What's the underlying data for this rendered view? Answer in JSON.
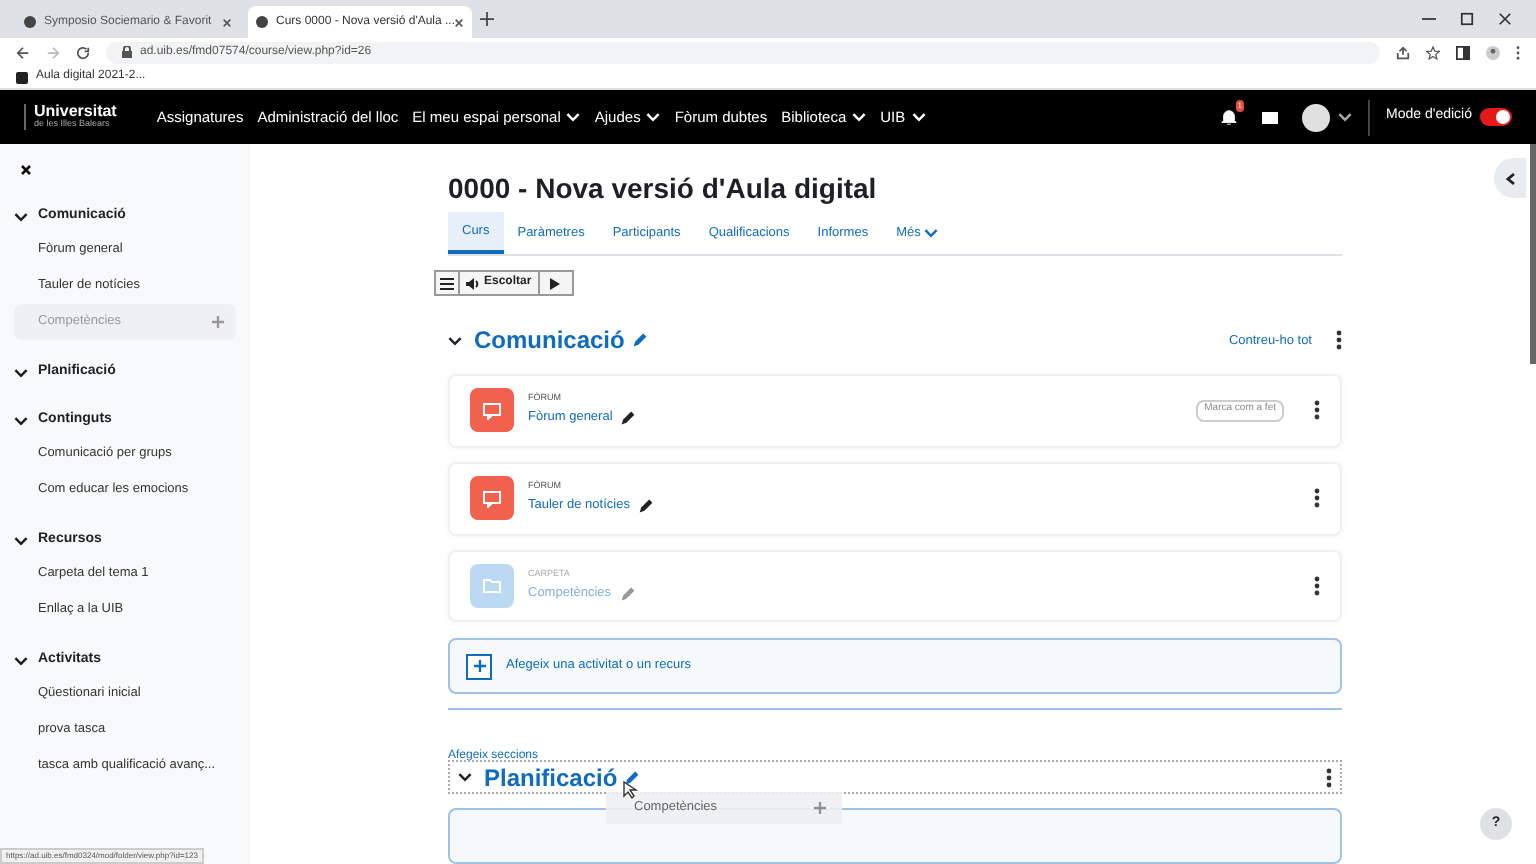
{
  "browser": {
    "tabs": [
      {
        "title": "Symposio Sociemario & Favorit",
        "selected": false
      },
      {
        "title": "Curs 0000 - Nova versió d'Aula ...",
        "selected": true
      }
    ],
    "url": "ad.uib.es/fmd07574/course/view.php?id=26",
    "bookmarks": [
      "Aula digital 2021-2..."
    ]
  },
  "nav": {
    "logo_title": "Universitat",
    "logo_subtitle": "de les Illes Balears",
    "items": [
      {
        "label": "Assignatures",
        "dropdown": false
      },
      {
        "label": "Administració del lloc",
        "dropdown": false
      },
      {
        "label": "El meu espai personal",
        "dropdown": true
      },
      {
        "label": "Ajudes",
        "dropdown": true
      },
      {
        "label": "Fòrum dubtes",
        "dropdown": false
      },
      {
        "label": "Biblioteca",
        "dropdown": true
      },
      {
        "label": "UIB",
        "dropdown": true
      }
    ],
    "notification_count": "1",
    "edit_mode": {
      "label": "Mode d'edició",
      "on": true
    }
  },
  "sidebar": {
    "sections": [
      {
        "title": "Comunicació",
        "expanded": true,
        "items": [
          {
            "label": "Fòrum general",
            "selected": false,
            "dimmed": false
          },
          {
            "label": "Tauler de notícies",
            "selected": false,
            "dimmed": false
          },
          {
            "label": "Competències",
            "selected": true,
            "dimmed": true
          }
        ]
      },
      {
        "title": "Planificació",
        "expanded": true
      },
      {
        "title": "Continguts",
        "expanded": true,
        "items": [
          {
            "label": "Comunicació per grups",
            "selected": false,
            "dimmed": false
          },
          {
            "label": "Com educar les emocions",
            "selected": false,
            "dimmed": false
          }
        ]
      },
      {
        "title": "Recursos",
        "expanded": true,
        "items": [
          {
            "label": "Carpeta del tema 1",
            "selected": false,
            "dimmed": false
          },
          {
            "label": "Enllaç a la UIB",
            "selected": false,
            "dimmed": false
          }
        ]
      },
      {
        "title": "Activitats",
        "expanded": true,
        "items": [
          {
            "label": "Qüestionari inicial",
            "selected": false,
            "dimmed": false
          },
          {
            "label": "prova tasca",
            "selected": false,
            "dimmed": false
          },
          {
            "label": "tasca amb qualificació avanç...",
            "selected": false,
            "dimmed": false
          }
        ]
      }
    ]
  },
  "main": {
    "title": "0000 - Nova versió d'Aula digital",
    "tabs": [
      {
        "label": "Curs",
        "selected": true,
        "dropdown": false
      },
      {
        "label": "Paràmetres",
        "selected": false,
        "dropdown": false
      },
      {
        "label": "Participants",
        "selected": false,
        "dropdown": false
      },
      {
        "label": "Qualificacions",
        "selected": false,
        "dropdown": false
      },
      {
        "label": "Informes",
        "selected": false,
        "dropdown": false
      },
      {
        "label": "Més",
        "selected": false,
        "dropdown": true
      }
    ],
    "player": {
      "label": "Escoltar"
    },
    "section": {
      "title": "Comunicació",
      "expanded": true,
      "collapse_all": "Contreu-ho tot",
      "activities": [
        {
          "kind": "forum",
          "type_label": "FÒRUM",
          "name": "Fòrum general",
          "action": "Marca com a fet",
          "dimmed": false
        },
        {
          "kind": "forum",
          "type_label": "FÒRUM",
          "name": "Tauler de notícies",
          "dimmed": false
        },
        {
          "kind": "folder",
          "type_label": "CARPETA",
          "name": "Competències",
          "dimmed": true
        }
      ]
    },
    "add_activity": "Afegeix una activitat o un recurs",
    "add_sections": "Afegeix seccions",
    "section2": {
      "title": "Planificació",
      "expanded": true
    },
    "drag_ghost": {
      "label": "Competències"
    }
  },
  "help": "?",
  "status_url": "https://ad.uib.es/fmd0324/mod/folder/view.php?id=123"
}
